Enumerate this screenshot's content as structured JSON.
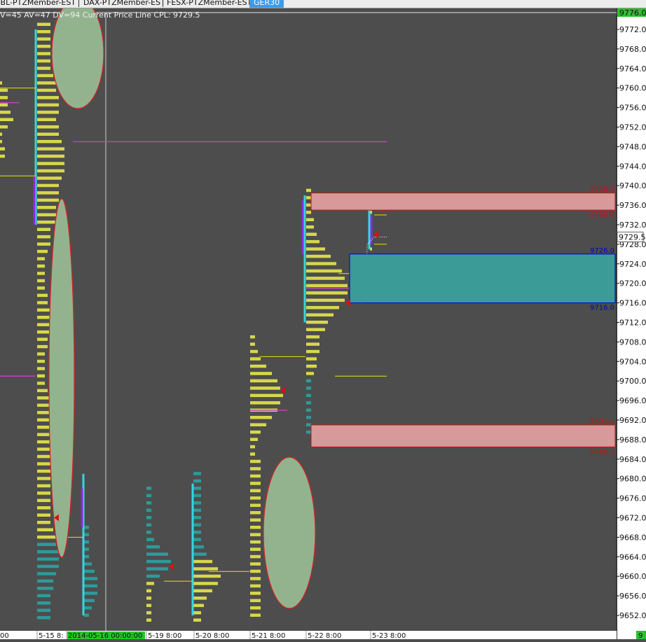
{
  "tabs": [
    {
      "label": "GBL-PTZMember-EST"
    },
    {
      "label": "DAX-PTZMember-EST"
    },
    {
      "label": "FESX-PTZMember-EST"
    },
    {
      "label": "GER30",
      "active": true
    }
  ],
  "header_text": "V=45 AV=47 DV=94 Current Price Line  CPL: 9729.5",
  "current_price": "9729.5",
  "top_price_tag": "9776.0",
  "bottom_right_tag": "9",
  "price_axis": [
    "9772.0",
    "9768.0",
    "9764.0",
    "9760.0",
    "9756.0",
    "9752.0",
    "9748.0",
    "9744.0",
    "9740.0",
    "9736.0",
    "9732.0",
    "9728.0",
    "9724.0",
    "9720.0",
    "9716.0",
    "9712.0",
    "9708.0",
    "9704.0",
    "9700.0",
    "9696.0",
    "9692.0",
    "9688.0",
    "9684.0",
    "9680.0",
    "9676.0",
    "9672.0",
    "9668.0",
    "9664.0",
    "9660.0",
    "9656.0",
    "9652.0"
  ],
  "zones": [
    {
      "top": "9738.5",
      "bottom": "9735.0",
      "kind": "supply"
    },
    {
      "top": "9726.0",
      "bottom": "9716.0",
      "kind": "demand"
    },
    {
      "top": "9691.0",
      "bottom": "9686.5",
      "kind": "supply"
    }
  ],
  "date_labels": [
    "00",
    "5-15  8:",
    "2014-05-16  00:00:00",
    "5-19  8:00",
    "5-20  8:00",
    "5-21  8:00",
    "5-22  8:00",
    "5-23  8:00"
  ],
  "colors": {
    "background": "#4d4d4d",
    "tpo_yellow": "#d8d84a",
    "tpo_teal": "#2e9a9a",
    "value_edge": "#35d6e0",
    "poc": "#c040c0",
    "supply_zone": "#d79999",
    "demand_zone": "#3a9b97",
    "ellipse": "#93b38f",
    "axis_bg": "#ffffff",
    "active_tab": "#3f9ae8"
  }
}
